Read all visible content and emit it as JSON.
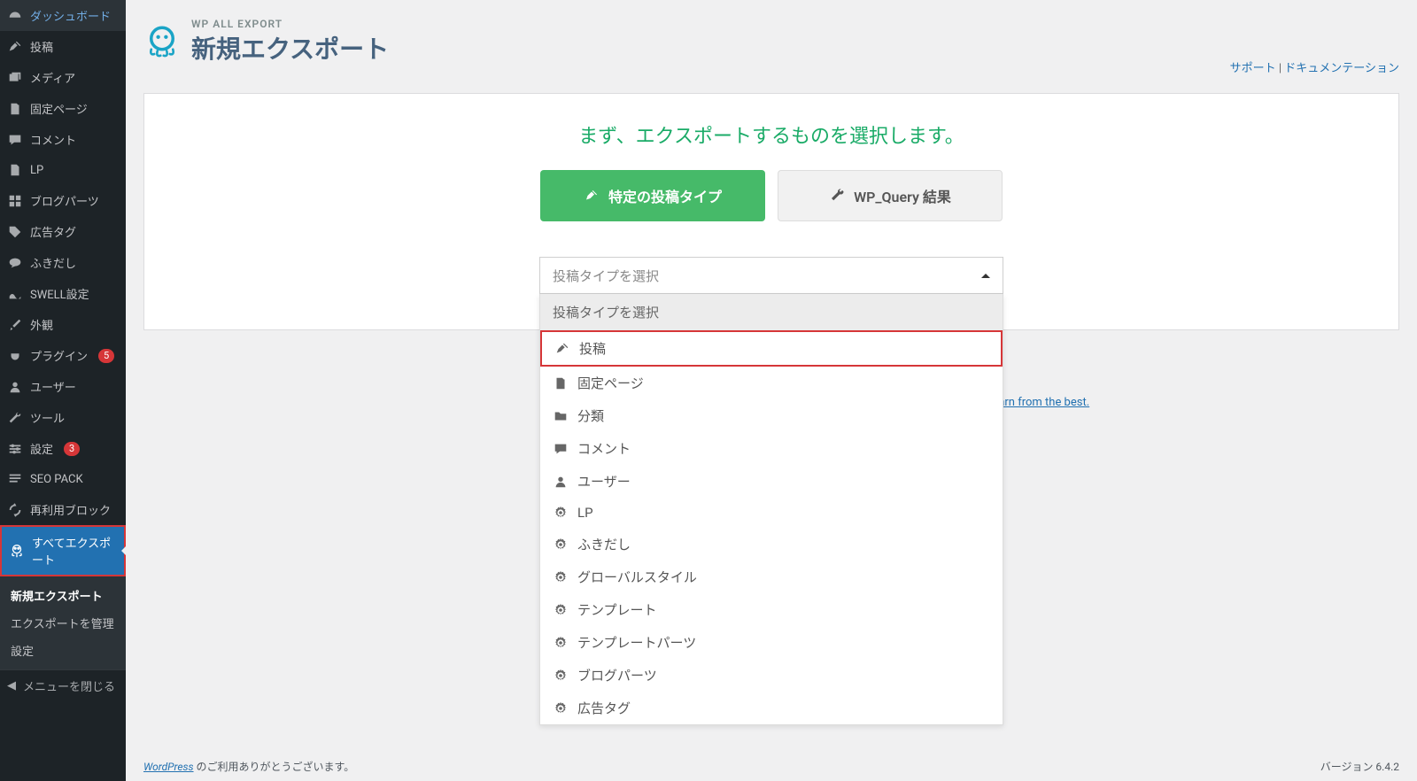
{
  "sidebar": {
    "items": [
      {
        "label": "ダッシュボード",
        "icon": "dashboard"
      },
      {
        "label": "投稿",
        "icon": "pin"
      },
      {
        "label": "メディア",
        "icon": "media"
      },
      {
        "label": "固定ページ",
        "icon": "page"
      },
      {
        "label": "コメント",
        "icon": "comment"
      },
      {
        "label": "LP",
        "icon": "file"
      },
      {
        "label": "ブログパーツ",
        "icon": "grid"
      },
      {
        "label": "広告タグ",
        "icon": "tag"
      },
      {
        "label": "ふきだし",
        "icon": "bubble"
      },
      {
        "label": "SWELL設定",
        "icon": "swell"
      },
      {
        "label": "外観",
        "icon": "brush"
      },
      {
        "label": "プラグイン",
        "icon": "plug",
        "badge": "5"
      },
      {
        "label": "ユーザー",
        "icon": "user"
      },
      {
        "label": "ツール",
        "icon": "wrench"
      },
      {
        "label": "設定",
        "icon": "settings",
        "badge": "3"
      },
      {
        "label": "SEO PACK",
        "icon": "seo"
      },
      {
        "label": "再利用ブロック",
        "icon": "recycle"
      },
      {
        "label": "すべてエクスポート",
        "icon": "octo",
        "active": true
      }
    ],
    "submenu": [
      {
        "label": "新規エクスポート",
        "current": true
      },
      {
        "label": "エクスポートを管理"
      },
      {
        "label": "設定"
      }
    ],
    "collapse": "メニューを閉じる"
  },
  "header": {
    "sub": "WP ALL EXPORT",
    "title": "新規エクスポート",
    "support": "サポート",
    "docs": "ドキュメンテーション"
  },
  "card": {
    "prompt": "まず、エクスポートするものを選択します。",
    "btn_primary": "特定の投稿タイプ",
    "btn_secondary": "WP_Query 結果",
    "select_placeholder": "投稿タイプを選択",
    "dropdown_head": "投稿タイプを選択",
    "options": [
      {
        "label": "投稿",
        "icon": "pin",
        "hl": true
      },
      {
        "label": "固定ページ",
        "icon": "page"
      },
      {
        "label": "分類",
        "icon": "folder"
      },
      {
        "label": "コメント",
        "icon": "comment"
      },
      {
        "label": "ユーザー",
        "icon": "user"
      },
      {
        "label": "LP",
        "icon": "gear"
      },
      {
        "label": "ふきだし",
        "icon": "gear"
      },
      {
        "label": "グローバルスタイル",
        "icon": "gear"
      },
      {
        "label": "テンプレート",
        "icon": "gear"
      },
      {
        "label": "テンプレートパーツ",
        "icon": "gear"
      },
      {
        "label": "ブログパーツ",
        "icon": "gear"
      },
      {
        "label": "広告タグ",
        "icon": "gear"
      }
    ]
  },
  "behind_link": "scuss, share your work, and learn from the best.",
  "footer": {
    "left_link": "WordPress",
    "left_text": " のご利用ありがとうございます。",
    "version": "バージョン 6.4.2"
  }
}
